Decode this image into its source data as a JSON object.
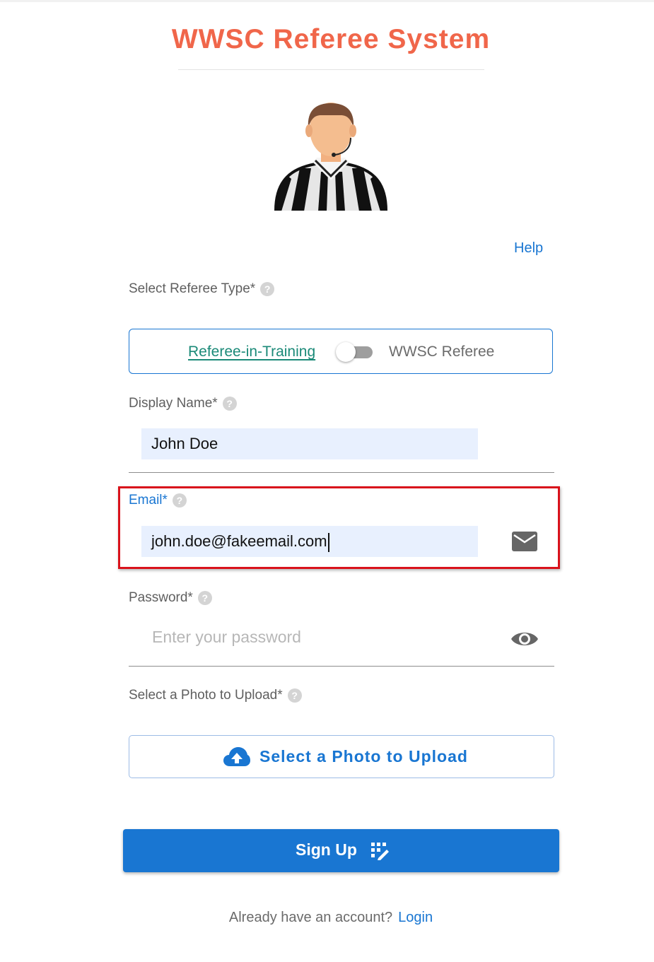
{
  "app": {
    "title": "WWSC Referee System",
    "brand_color": "#f0664a",
    "accent_color": "#1976d2"
  },
  "help": {
    "label": "Help"
  },
  "referee_type": {
    "label": "Select Referee Type*",
    "help_icon": "help-circle-icon",
    "option_left": "Referee-in-Training",
    "option_right": "WWSC Referee",
    "switch_on": false
  },
  "display_name": {
    "label": "Display Name*",
    "value": "John Doe",
    "help_icon": "help-circle-icon"
  },
  "email": {
    "label": "Email*",
    "value": "john.doe@fakeemail.com",
    "icon": "mail-icon",
    "help_icon": "help-circle-icon",
    "highlight_color": "#d9121b"
  },
  "password": {
    "label": "Password*",
    "placeholder": "Enter your password",
    "icon": "eye-icon",
    "help_icon": "help-circle-icon"
  },
  "photo": {
    "label": "Select a Photo to Upload*",
    "button_label": "Select a Photo to Upload",
    "icon": "cloud-upload-icon",
    "help_icon": "help-circle-icon"
  },
  "signup": {
    "label": "Sign Up",
    "icon": "signup-icon"
  },
  "footer": {
    "prompt": "Already have an account?",
    "login_label": "Login"
  }
}
